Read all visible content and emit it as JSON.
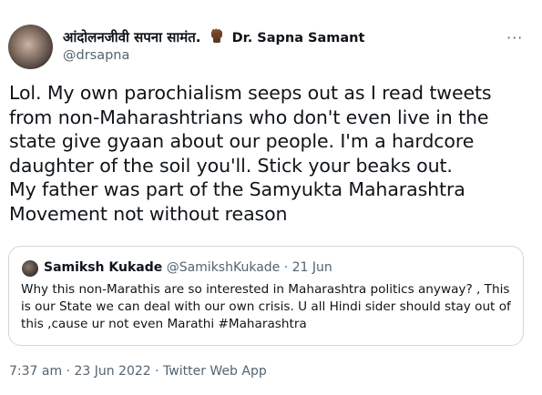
{
  "author": {
    "name_devanagari": "आंदोलनजीवी सपना सामंत.",
    "name_latin": "Dr. Sapna Samant",
    "handle": "@drsapna",
    "emoji": "raised-fist-dark-skin"
  },
  "more_label": "···",
  "tweet_lines": [
    "Lol. My own parochialism seeps out as I read tweets",
    "from non-Maharashtrians who don't even live in the",
    "state give gyaan about our people. I'm a hardcore",
    "daughter of the soil you'll. Stick your beaks out.",
    "My father was part of the Samyukta Maharashtra",
    "Movement not without reason"
  ],
  "quoted": {
    "name": "Samiksh Kukade",
    "handle": "@SamikshKukade",
    "separator": "·",
    "date": "21 Jun",
    "lines": [
      "Why this non-Marathis are so interested in Maharashtra politics anyway? , This",
      "is our State we can deal with our own crisis. U all Hindi sider should stay out of",
      "this ,cause ur not even Marathi #Maharashtra"
    ]
  },
  "meta": {
    "time": "7:37 am",
    "separator": "·",
    "date": "23 Jun 2022",
    "source": "Twitter Web App"
  }
}
